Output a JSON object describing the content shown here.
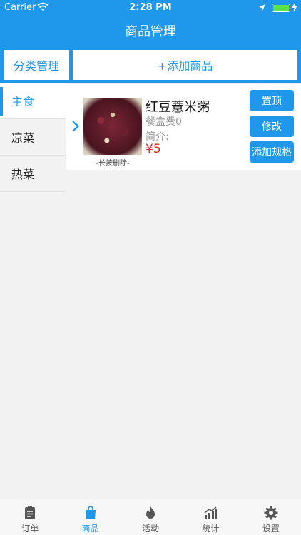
{
  "status_bar": {
    "carrier": "Carrier",
    "time": "2:28 PM"
  },
  "nav": {
    "title": "商品管理"
  },
  "toolbar": {
    "category_manage": "分类管理",
    "add_product": "+添加商品"
  },
  "sidebar": {
    "items": [
      {
        "label": "主食",
        "active": true
      },
      {
        "label": "凉菜",
        "active": false
      },
      {
        "label": "热菜",
        "active": false
      }
    ]
  },
  "product": {
    "name": "红豆薏米粥",
    "box_fee": "餐盒费0",
    "description": "简介:",
    "price": "¥5",
    "image_caption": "-长按删除-",
    "actions": {
      "pin_top": "置顶",
      "edit": "修改",
      "add_spec": "添加规格"
    }
  },
  "tabbar": {
    "items": [
      {
        "label": "订单",
        "icon": "clipboard-icon",
        "active": false
      },
      {
        "label": "商品",
        "icon": "shopping-bag-icon",
        "active": true
      },
      {
        "label": "活动",
        "icon": "flame-icon",
        "active": false
      },
      {
        "label": "统计",
        "icon": "chart-icon",
        "active": false
      },
      {
        "label": "设置",
        "icon": "gear-icon",
        "active": false
      }
    ]
  },
  "colors": {
    "primary": "#1f97ea",
    "price": "#e02020",
    "battery": "#5de24a"
  }
}
